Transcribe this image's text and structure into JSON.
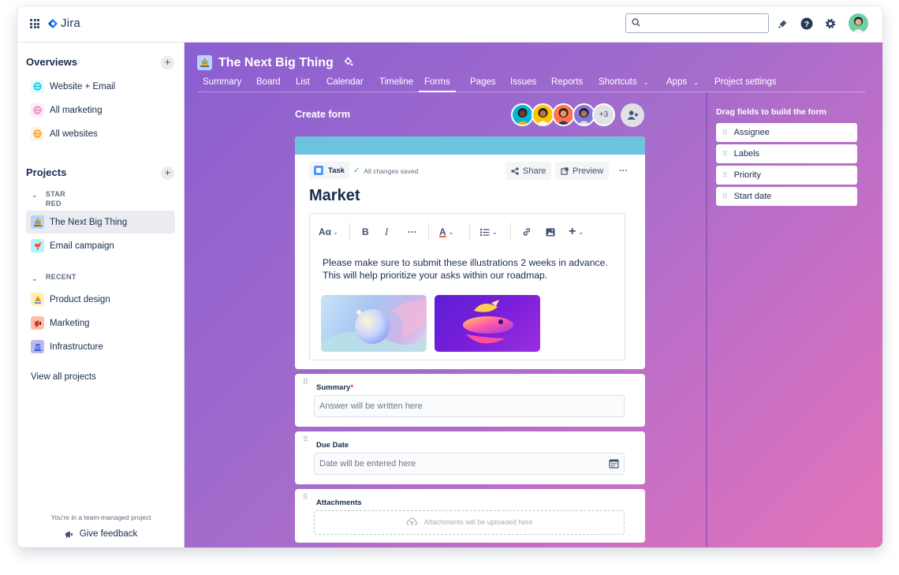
{
  "topbar": {
    "product_name": "Jira",
    "search": {
      "value": "",
      "placeholder": ""
    },
    "icons": [
      "apps-grid-icon",
      "notifications-icon",
      "help-icon",
      "settings-icon",
      "user-avatar"
    ]
  },
  "sidebar": {
    "overviews_heading": "Overviews",
    "overviews": [
      {
        "label": "Website + Email",
        "icon": "globe-icon",
        "color": "#00b8d9"
      },
      {
        "label": "All marketing",
        "icon": "globe-icon",
        "color": "#e774bb"
      },
      {
        "label": "All websites",
        "icon": "globe-icon",
        "color": "#ff8b00"
      }
    ],
    "projects_heading": "Projects",
    "starred_group": "STAR RED",
    "starred_group_line1": "STAR",
    "starred_group_line2": "RED",
    "starred": [
      {
        "label": "The Next Big Thing",
        "icon": "robot-icon",
        "active": true
      },
      {
        "label": "Email campaign",
        "icon": "mailbox-icon",
        "active": false
      }
    ],
    "recent_group": "RECENT",
    "recent": [
      {
        "label": "Product design",
        "icon": "sailboat-icon"
      },
      {
        "label": "Marketing",
        "icon": "megaphone-icon"
      },
      {
        "label": "Infrastructure",
        "icon": "server-icon"
      }
    ],
    "view_all": "View all projects",
    "footer_note": "You're in a team-managed project",
    "feedback": "Give feedback"
  },
  "project": {
    "title": "The Next Big Thing",
    "tabs": [
      {
        "label": "Summary",
        "active": false
      },
      {
        "label": "Board",
        "active": false
      },
      {
        "label": "List",
        "active": false
      },
      {
        "label": "Calendar",
        "active": false
      },
      {
        "label": "Timeline",
        "active": false
      },
      {
        "label": "Forms",
        "active": true
      },
      {
        "label": "Pages",
        "active": false
      },
      {
        "label": "Issues",
        "active": false
      },
      {
        "label": "Reports",
        "active": false
      },
      {
        "label": "Shortcuts",
        "active": false,
        "dropdown": true
      },
      {
        "label": "Apps",
        "active": false,
        "dropdown": true
      },
      {
        "label": "Project settings",
        "active": false
      }
    ]
  },
  "form": {
    "create_label": "Create form",
    "collaborators_more": "+3",
    "issue_type": "Task",
    "save_status": "All changes saved",
    "share_label": "Share",
    "preview_label": "Preview",
    "title": "Market",
    "toolbar": {
      "text_style": "Aα"
    },
    "description": "Please make sure to submit these illustrations 2 weeks in advance. This will help prioritize your asks within our roadmap.",
    "fields": [
      {
        "label": "Summary",
        "required": true,
        "placeholder": "Answer will be written here"
      },
      {
        "label": "Due Date",
        "required": false,
        "placeholder": "Date will be entered here"
      },
      {
        "label": "Attachments",
        "required": false,
        "placeholder": "Attachments will be uploaded here"
      }
    ],
    "band_color": "#6cc3e0"
  },
  "drag_panel": {
    "title": "Drag fields to build the form",
    "items": [
      "Assignee",
      "Labels",
      "Priority",
      "Start date"
    ]
  }
}
